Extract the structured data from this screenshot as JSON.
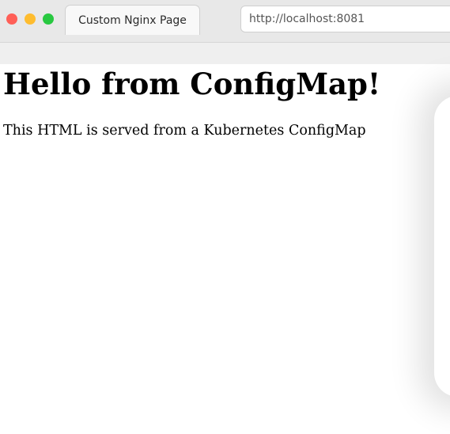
{
  "browser": {
    "tab_title": "Custom Nginx Page",
    "address_url": "http://localhost:8081"
  },
  "page": {
    "heading": "Hello from ConfigMap!",
    "paragraph": "This HTML is served from a Kubernetes ConfigMap"
  },
  "colors": {
    "traffic_close": "#ff5f57",
    "traffic_minimize": "#febc2e",
    "traffic_maximize": "#28c840"
  }
}
